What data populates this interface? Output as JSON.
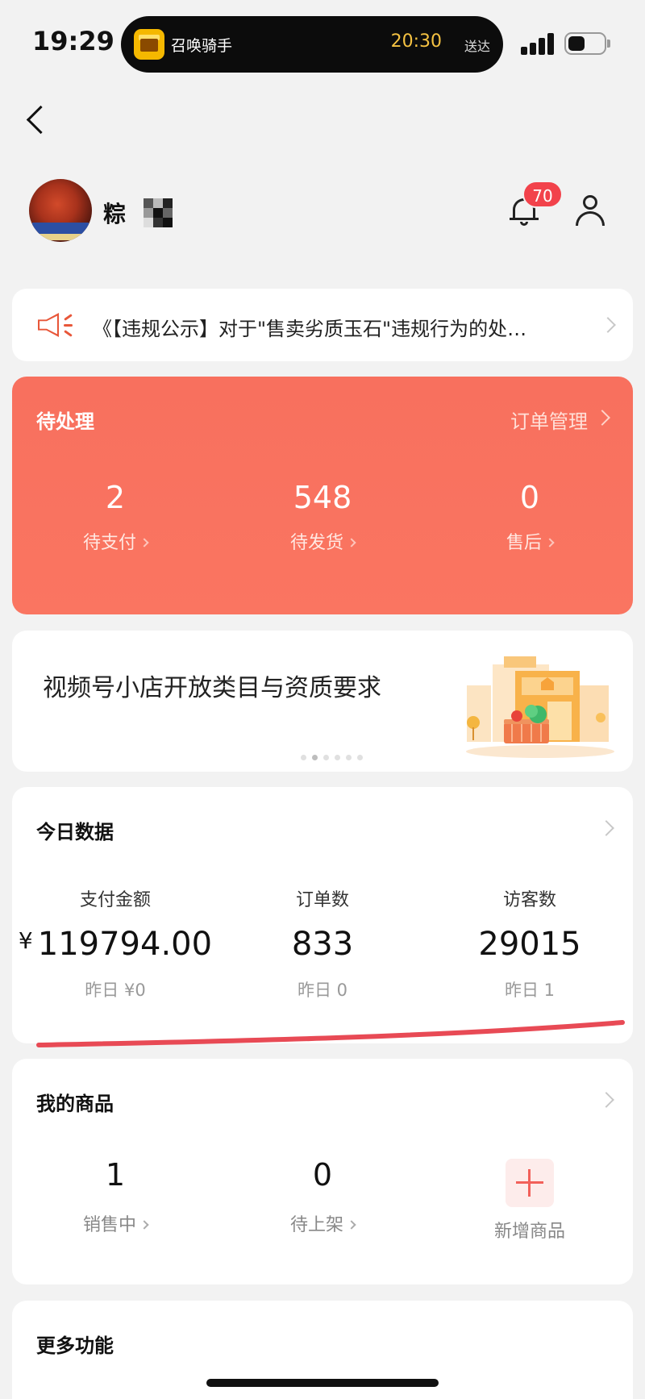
{
  "status_bar": {
    "time": "19:29",
    "live_activity": {
      "app": "召唤骑手",
      "eta": "20:30",
      "eta_suffix": "送达"
    }
  },
  "header": {
    "shop_name": "粽",
    "notifications_count": "70"
  },
  "notice": {
    "text": "《【违规公示】对于\"售卖劣质玉石\"违规行为的处…"
  },
  "pending": {
    "title": "待处理",
    "link": "订单管理",
    "items": [
      {
        "value": "2",
        "label": "待支付"
      },
      {
        "value": "548",
        "label": "待发货"
      },
      {
        "value": "0",
        "label": "售后"
      }
    ]
  },
  "banner": {
    "text": "视频号小店开放类目与资质要求",
    "pages": 6,
    "active_page": 2
  },
  "today": {
    "title": "今日数据",
    "columns": [
      {
        "label": "支付金额",
        "currency": "¥",
        "value": "119794.00",
        "yesterday": "昨日 ¥0"
      },
      {
        "label": "订单数",
        "value": "833",
        "yesterday": "昨日 0"
      },
      {
        "label": "访客数",
        "value": "29015",
        "yesterday": "昨日 1"
      }
    ]
  },
  "goods": {
    "title": "我的商品",
    "items": [
      {
        "value": "1",
        "label": "销售中"
      },
      {
        "value": "0",
        "label": "待上架"
      }
    ],
    "add_label": "新增商品"
  },
  "more": {
    "title": "更多功能"
  },
  "colors": {
    "accent": "#f8705e",
    "badge": "#f2424b",
    "background": "#f2f2f2",
    "annotation_stroke": "#e84a55"
  }
}
